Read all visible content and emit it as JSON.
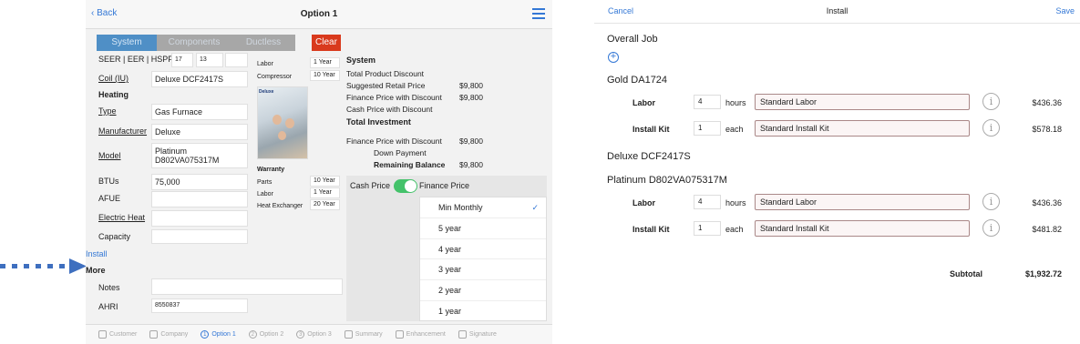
{
  "left": {
    "back_label": "Back",
    "title": "Option 1",
    "segments": [
      "System",
      "Components",
      "Ductless"
    ],
    "clear_label": "Clear",
    "seer_label": "SEER | EER | HSPF",
    "seer_values": [
      "17",
      "13",
      ""
    ],
    "coil_label": "Coil (IU)",
    "coil_value": "Deluxe DCF2417S",
    "heating_label": "Heating",
    "type_label": "Type",
    "type_value": "Gas Furnace",
    "manufacturer_label": "Manufacturer",
    "manufacturer_value": "Deluxe",
    "model_label": "Model",
    "model_value_1": "Platinum",
    "model_value_2": "D802VA075317M",
    "btus_label": "BTUs",
    "btus_value": "75,000",
    "afue_label": "AFUE",
    "electric_heat_label": "Electric Heat",
    "capacity_label": "Capacity",
    "install_label": "Install",
    "more_label": "More",
    "notes_label": "Notes",
    "ahri_label": "AHRI",
    "ahri_value": "8550837",
    "labor_label": "Labor",
    "labor_value": "1 Year",
    "compressor_label": "Compressor",
    "compressor_value": "10 Year",
    "brand_logo_text": "Deluxe",
    "warranty_label": "Warranty",
    "parts_label": "Parts",
    "parts_value": "10 Year",
    "w_labor_label": "Labor",
    "w_labor_value": "1 Year",
    "heat_exchanger_label": "Heat Exchanger",
    "heat_exchanger_value": "20 Year",
    "system": {
      "heading": "System",
      "total_product_discount": "Total Product Discount",
      "suggested_retail_label": "Suggested Retail Price",
      "suggested_retail_value": "$9,800",
      "finance_discount_label": "Finance Price with Discount",
      "finance_discount_value": "$9,800",
      "cash_discount_label": "Cash Price with Discount",
      "total_investment": "Total Investment",
      "finance_discount_label_2": "Finance Price with Discount",
      "finance_discount_value_2": "$9,800",
      "down_payment_label": "Down Payment",
      "remaining_label": "Remaining Balance",
      "remaining_value": "$9,800"
    },
    "cash_price_label": "Cash Price",
    "finance_price_label": "Finance Price",
    "dropdown": [
      "Min Monthly",
      "5 year",
      "4 year",
      "3 year",
      "2 year",
      "1 year"
    ],
    "tabs": [
      "Customer",
      "Company",
      "Option 1",
      "Option 2",
      "Option 3",
      "Summary",
      "Enhancement",
      "Signature"
    ]
  },
  "right": {
    "cancel_label": "Cancel",
    "title": "Install",
    "save_label": "Save",
    "overall_job": "Overall Job",
    "gold_heading": "Gold DA1724",
    "deluxe_heading": "Deluxe DCF2417S",
    "platinum_heading": "Platinum D802VA075317M",
    "rows": [
      {
        "label": "Labor",
        "qty": "4",
        "unit": "hours",
        "desc": "Standard Labor",
        "price": "$436.36"
      },
      {
        "label": "Install Kit",
        "qty": "1",
        "unit": "each",
        "desc": "Standard Install Kit",
        "price": "$578.18"
      },
      {
        "label": "Labor",
        "qty": "4",
        "unit": "hours",
        "desc": "Standard Labor",
        "price": "$436.36"
      },
      {
        "label": "Install Kit",
        "qty": "1",
        "unit": "each",
        "desc": "Standard Install Kit",
        "price": "$481.82"
      }
    ],
    "subtotal_label": "Subtotal",
    "subtotal_value": "$1,932.72"
  },
  "colors": {
    "accent": "#3478d6",
    "clear": "#d93a1d",
    "toggle": "#44c26a"
  }
}
